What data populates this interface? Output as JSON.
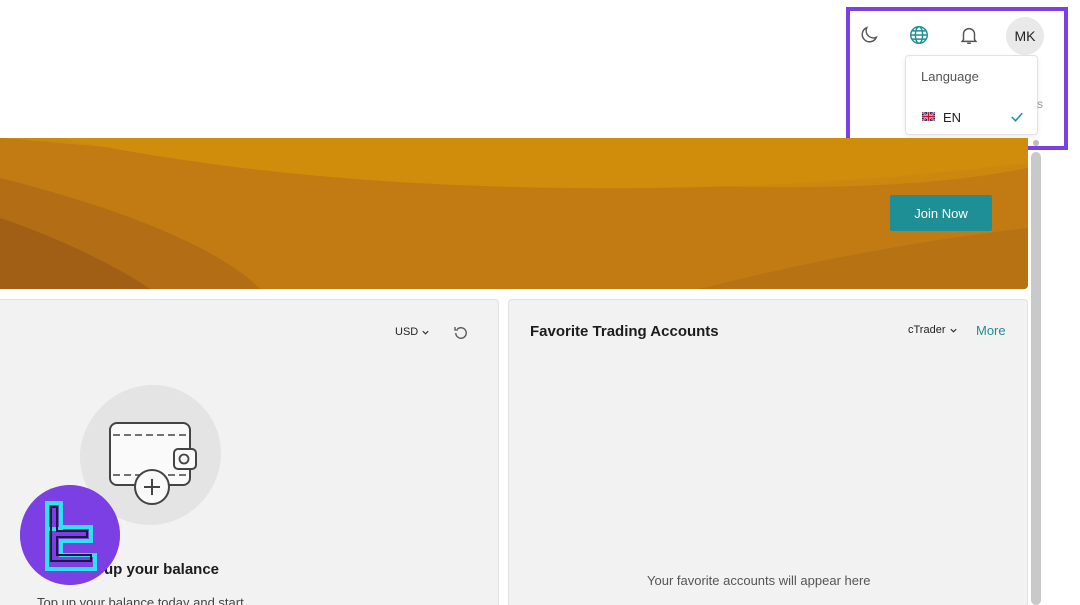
{
  "header": {
    "theme_icon": "moon-icon",
    "language_icon": "globe-icon",
    "notifications_icon": "bell-icon",
    "avatar_initials": "MK"
  },
  "language_menu": {
    "title": "Language",
    "items": [
      {
        "code": "EN",
        "flag": "uk-flag-icon",
        "selected": true
      }
    ]
  },
  "banner": {
    "join_button": "Join Now"
  },
  "balance_card": {
    "currency": "USD",
    "refresh_icon": "refresh-icon",
    "illustration": "wallet-add-icon",
    "title": "up your balance",
    "subtitle": "Top up your balance today and start"
  },
  "favorites_card": {
    "title": "Favorite Trading Accounts",
    "platform": "cTrader",
    "more_link": "More",
    "empty_text": "Your favorite accounts will appear here"
  },
  "colors": {
    "accent": "#1e8f95",
    "highlight": "#7b3fe4",
    "banner": "#c27a12"
  }
}
